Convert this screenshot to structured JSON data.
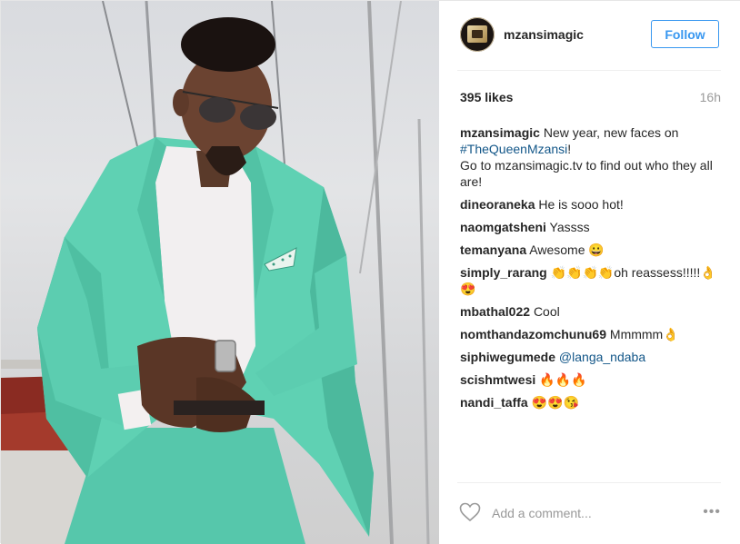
{
  "post": {
    "username": "mzansimagic",
    "follow_label": "Follow",
    "likes": "395 likes",
    "time_ago": "16h"
  },
  "caption": {
    "user": "mzansimagic",
    "line1": "New year, new faces on",
    "hashtag": "#TheQueenMzansi",
    "line1_end": "!",
    "line2": "Go to mzansimagic.tv to find out who they all are!"
  },
  "comments": [
    {
      "user": "dineoraneka",
      "text": "He is sooo hot!"
    },
    {
      "user": "naomgatsheni",
      "text": "Yassss"
    },
    {
      "user": "temanyana",
      "text": "Awesome 😀"
    },
    {
      "user": "simply_rarang",
      "text": "👏👏👏👏oh reassess!!!!!👌😍"
    },
    {
      "user": "mbathal022",
      "text": "Cool"
    },
    {
      "user": "nomthandazomchunu69",
      "text": "Mmmmm👌"
    },
    {
      "user": "siphiwegumede",
      "mention": "@langa_ndaba"
    },
    {
      "user": "scishmtwesi",
      "text": "🔥🔥🔥"
    },
    {
      "user": "nandi_taffa",
      "text": "😍😍😘"
    }
  ],
  "footer": {
    "comment_placeholder": "Add a comment...",
    "more_label": "•••"
  },
  "colors": {
    "accent": "#3897f0",
    "link": "#125688",
    "suit": "#5fd1b3"
  },
  "icons": {
    "heart": "heart-outline-icon",
    "avatar": "mzansi-magic-logo"
  }
}
